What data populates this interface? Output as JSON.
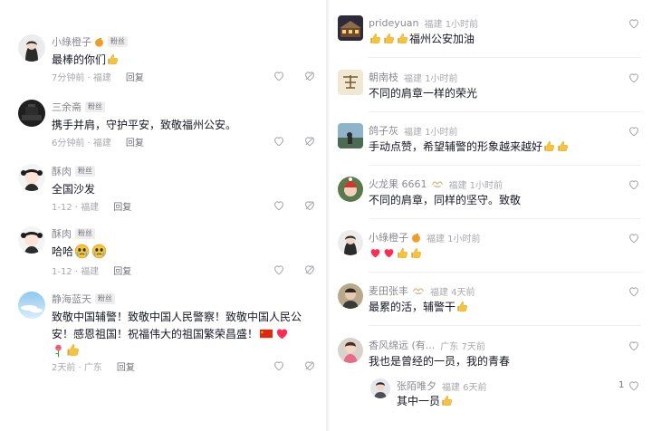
{
  "badge_fan": "粉丝",
  "reply_label": "回复",
  "left": [
    {
      "user": "小綠橙子",
      "text": "最棒的你们",
      "time": "7分钟前 · 福建"
    },
    {
      "user": "三余斋",
      "text": "携手并肩，守护平安，致敬福州公安。",
      "time": "6分钟前 · 福建"
    },
    {
      "user": "酥肉",
      "text": "全国沙发",
      "time": "1-12 · 福建"
    },
    {
      "user": "酥肉",
      "text": "哈哈",
      "time": "1-12 · 福建"
    },
    {
      "user": "静海蓝天",
      "text_line1": "致敬中国辅警！致敬中国人民警察！致敬中国人民公",
      "text_line2": "安！感恩祖国！祝福伟大的祖国繁荣昌盛！",
      "time": "2天前 · 广东"
    }
  ],
  "right": [
    {
      "user": "prideyuan",
      "meta": "福建 1小时前",
      "text": "福州公安加油"
    },
    {
      "user": "朝南枝",
      "meta": "福建 1小时前",
      "text": "不同的肩章一样的荣光"
    },
    {
      "user": "鸽子灰",
      "meta": "福建 1小时前",
      "text": "手动点赞，希望辅警的形象越来越好"
    },
    {
      "user": "火龙果 6661",
      "meta": "福建 1小时前",
      "text": "不同的肩章，同样的坚守。致敬"
    },
    {
      "user": "小綠橙子",
      "meta": "福建 1小时前",
      "text": ""
    },
    {
      "user": "麦田张丰",
      "meta": "福建 4天前",
      "text": "最累的活，辅警干"
    },
    {
      "user": "香风绵远 (有...",
      "meta": "广东 7天前",
      "text": "我也是曾经的一员，我的青春"
    },
    {
      "user": "张陌唯夕",
      "meta": "福建 6天前",
      "text": "其中一员",
      "likes": "1"
    }
  ],
  "colors": {
    "text_primary": "#161823",
    "text_secondary": "#8a8b91",
    "text_muted": "#a8a9ae",
    "badge_bg": "#eeeeef",
    "heart_red": "#fe2c55",
    "emoji_yellow": "#f7c33c"
  },
  "icons": [
    "heart-outline-icon",
    "dislike-heart-icon",
    "thumbs-up-emoji",
    "crying-face-emoji",
    "red-heart-emoji",
    "china-flag-emoji",
    "rose-emoji",
    "tangerine-emoji",
    "handshake-icon"
  ]
}
